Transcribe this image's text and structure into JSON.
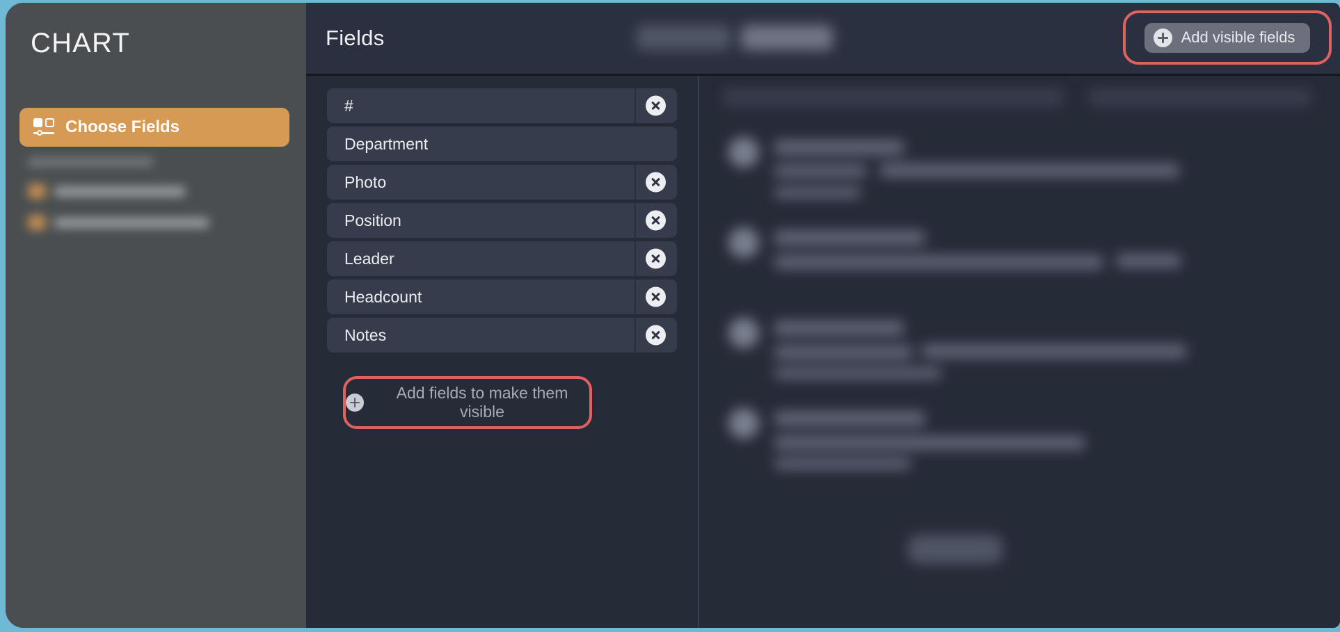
{
  "window": {
    "desktop_bg": "#6fb9d6",
    "surface_bg": "#262b38"
  },
  "sidebar": {
    "title": "CHART",
    "accent_color": "#d79a55",
    "primary_button": {
      "label": "Choose Fields",
      "icon": "choose-fields-icon",
      "active": true
    },
    "obscured_section": {
      "heading_redacted": true,
      "item_count": 2,
      "note": "section heading and two list items are blurred/redacted in the screenshot"
    }
  },
  "header": {
    "title": "Fields",
    "segmented_control": {
      "redacted": true,
      "segment_count": 2,
      "selected_index": 1
    },
    "add_visible_fields_button": {
      "label": "Add visible fields",
      "icon": "plus-circle-icon",
      "highlighted": true,
      "highlight_color": "#e0625f"
    }
  },
  "fields_panel": {
    "rows": [
      {
        "name": "#",
        "removable": true
      },
      {
        "name": "Department",
        "removable": false
      },
      {
        "name": "Photo",
        "removable": true
      },
      {
        "name": "Position",
        "removable": true
      },
      {
        "name": "Leader",
        "removable": true
      },
      {
        "name": "Headcount",
        "removable": true
      },
      {
        "name": "Notes",
        "removable": true
      }
    ],
    "add_fields_button": {
      "label": "Add fields to make them visible",
      "icon": "plus-circle-icon",
      "highlighted": true,
      "highlight_color": "#e0625f"
    }
  },
  "preview_panel": {
    "redacted": true,
    "item_count": 4,
    "has_footer_button": true,
    "note": "right-hand preview list is blurred/redacted in the screenshot"
  }
}
